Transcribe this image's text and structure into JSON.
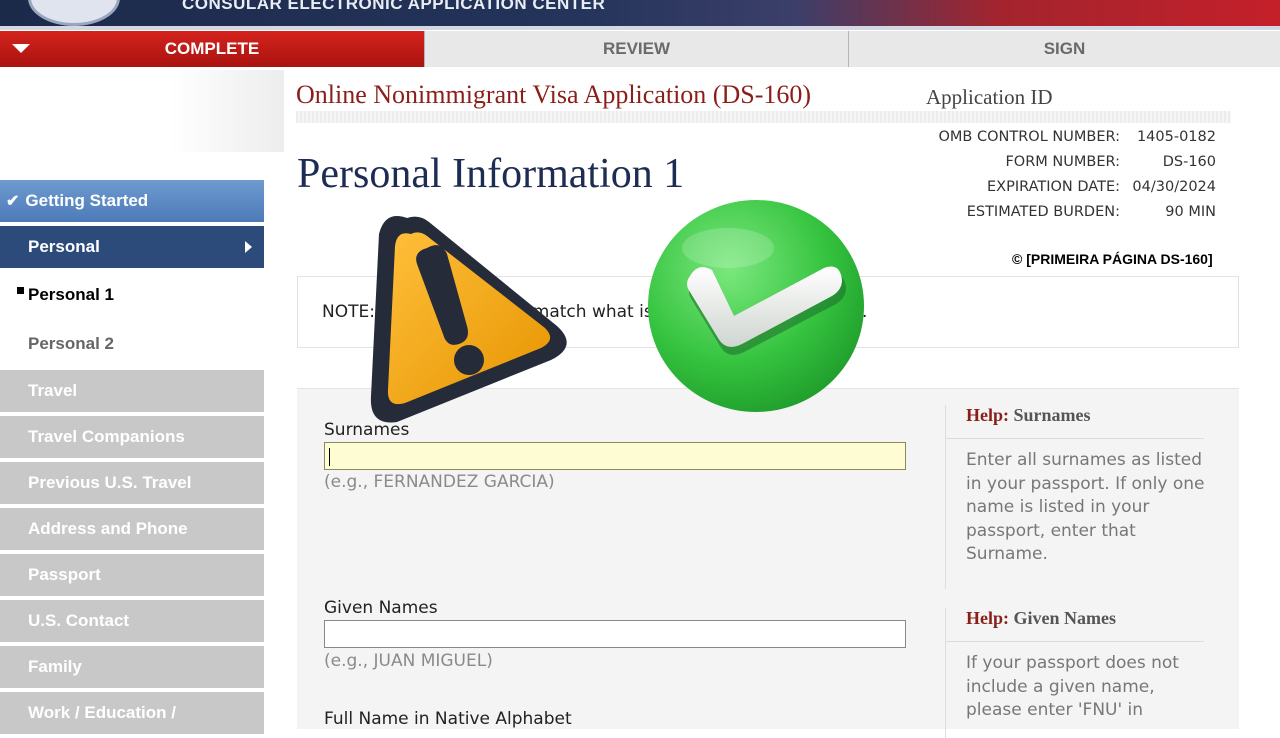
{
  "banner": {
    "title": "CONSULAR ELECTRONIC APPLICATION CENTER"
  },
  "steps": [
    {
      "label": "COMPLETE"
    },
    {
      "label": "REVIEW"
    },
    {
      "label": "SIGN"
    }
  ],
  "nav": {
    "getting_started": "Getting Started",
    "personal": "Personal",
    "personal1": "Personal 1",
    "personal2": "Personal 2",
    "items": [
      "Travel",
      "Travel Companions",
      "Previous U.S. Travel",
      "Address and Phone",
      "Passport",
      "U.S. Contact",
      "Family",
      "Work / Education /"
    ]
  },
  "header": {
    "app_title": "Online Nonimmigrant Visa Application (DS-160)",
    "app_id_label": "Application ID",
    "omb": [
      {
        "label": "OMB CONTROL NUMBER:",
        "value": "1405-0182"
      },
      {
        "label": "FORM NUMBER:",
        "value": "DS-160"
      },
      {
        "label": "EXPIRATION DATE:",
        "value": "04/30/2024"
      },
      {
        "label": "ESTIMATED BURDEN:",
        "value": "90 MIN"
      }
    ]
  },
  "page": {
    "title": "Personal Information 1",
    "copyright": "© [PRIMEIRA PÁGINA DS-160]",
    "note": "NOTE: Your names must match what is written in your passport."
  },
  "form": {
    "surnames_label": "Surnames",
    "surnames_value": "",
    "surnames_example": "(e.g., FERNANDEZ GARCIA)",
    "given_label": "Given Names",
    "given_value": "",
    "given_example": "(e.g., JUAN MIGUEL)",
    "native_label": "Full Name in Native Alphabet"
  },
  "help": {
    "prefix": "Help:",
    "surnames_title": "Surnames",
    "surnames_body": "Enter all surnames as listed in your passport. If only one name is listed in your passport, enter that Surname.",
    "given_title": "Given Names",
    "given_body": "If your passport does not include a given name, please enter 'FNU' in"
  },
  "overlay": {
    "warning_icon": "warning-icon",
    "check_icon": "checkmark-icon"
  },
  "colors": {
    "brand_red": "#c4202a",
    "navy": "#1d2c52",
    "nav_blue": "#4d7bb8",
    "nav_dark": "#2d4b7a",
    "warning": "#f4a91c",
    "success": "#3fcf4f"
  }
}
